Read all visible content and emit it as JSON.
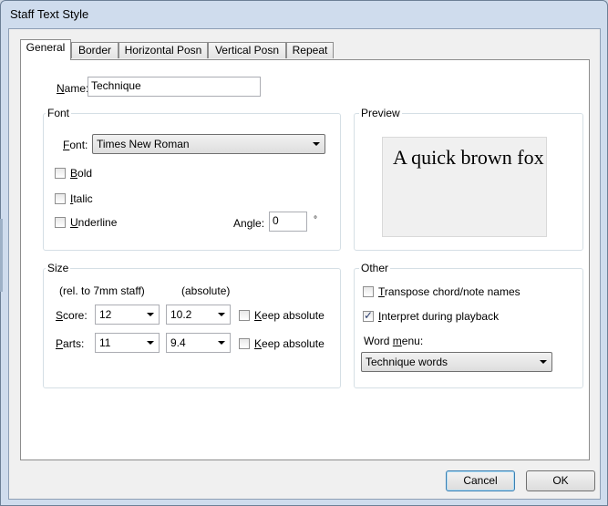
{
  "window": {
    "title": "Staff Text Style"
  },
  "tabs": [
    "General",
    "Border",
    "Horizontal Posn",
    "Vertical Posn",
    "Repeat"
  ],
  "name_field": {
    "label_u": "N",
    "label_rest": "ame:",
    "value": "Technique"
  },
  "font_group": {
    "label": "Font",
    "font_label_u": "F",
    "font_label_rest": "ont:",
    "font_value": "Times New Roman",
    "bold": {
      "u": "B",
      "rest": "old",
      "checked": false
    },
    "italic": {
      "u": "I",
      "rest": "talic",
      "checked": false
    },
    "underline": {
      "u": "U",
      "rest": "nderline",
      "checked": false
    },
    "angle_label_pre": "An",
    "angle_label_u": "g",
    "angle_label_post": "le:",
    "angle_value": "0",
    "angle_unit": "°"
  },
  "preview_group": {
    "label": "Preview",
    "text": "A quick brown fox"
  },
  "size_group": {
    "label": "Size",
    "rel_header": "(rel. to 7mm staff)",
    "abs_header": "(absolute)",
    "score": {
      "label_u": "S",
      "label_rest": "core:",
      "rel": "12",
      "abs": "10.2",
      "keep_u": "K",
      "keep_rest": "eep absolute"
    },
    "parts": {
      "label_u": "P",
      "label_rest": "arts:",
      "rel": "11",
      "abs": "9.4",
      "keep_u": "K",
      "keep_rest": "eep absolute"
    }
  },
  "other_group": {
    "label": "Other",
    "transpose": {
      "u": "T",
      "rest": "ranspose chord/note names",
      "checked": false
    },
    "interpret": {
      "u": "I",
      "rest": "nterpret during playback",
      "checked": true
    },
    "word_menu_label_pre": "Word ",
    "word_menu_label_u": "m",
    "word_menu_label_post": "enu:",
    "word_menu_value": "Technique words"
  },
  "buttons": {
    "cancel": "Cancel",
    "ok": "OK"
  },
  "check_glyph": "✓"
}
